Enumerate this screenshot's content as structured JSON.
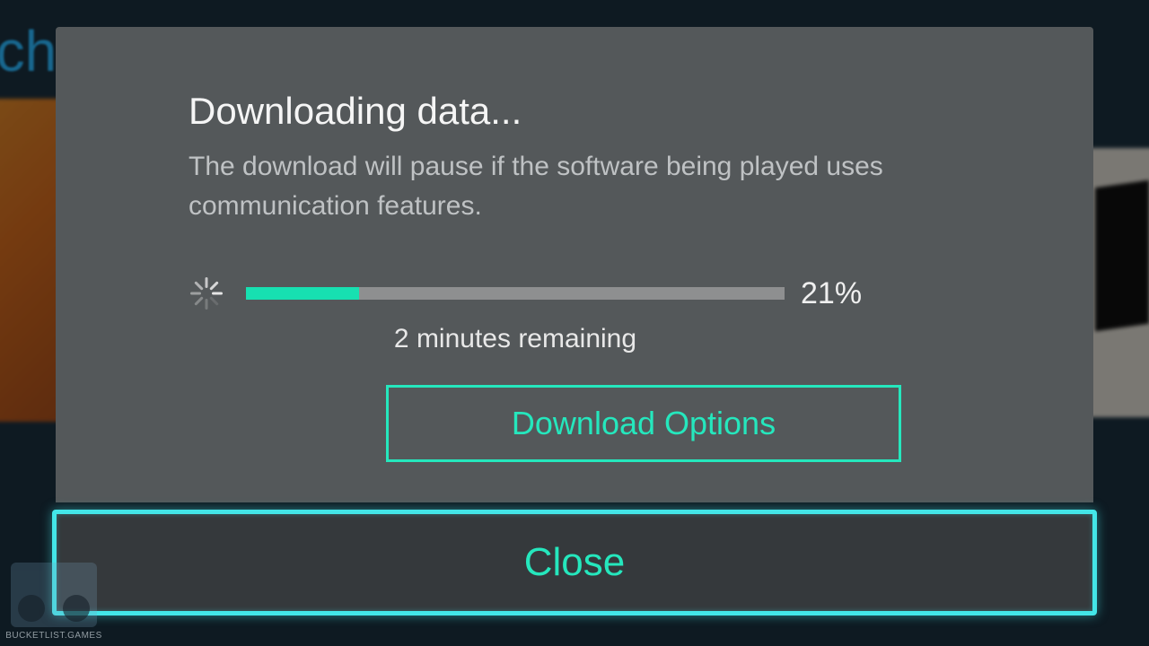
{
  "background": {
    "partial_title": "nch",
    "watermark_text": "BUCKETLIST.GAMES"
  },
  "dialog": {
    "title": "Downloading data...",
    "message": "The download will pause if the software being played uses communication features.",
    "progress_percent": 21,
    "progress_label": "21%",
    "time_remaining": "2 minutes remaining",
    "options_button": "Download Options",
    "close_button": "Close"
  },
  "colors": {
    "accent": "#25e7bd",
    "focus_ring": "#43e6e8",
    "modal_bg": "#54585a",
    "page_bg": "#0e1a22"
  }
}
